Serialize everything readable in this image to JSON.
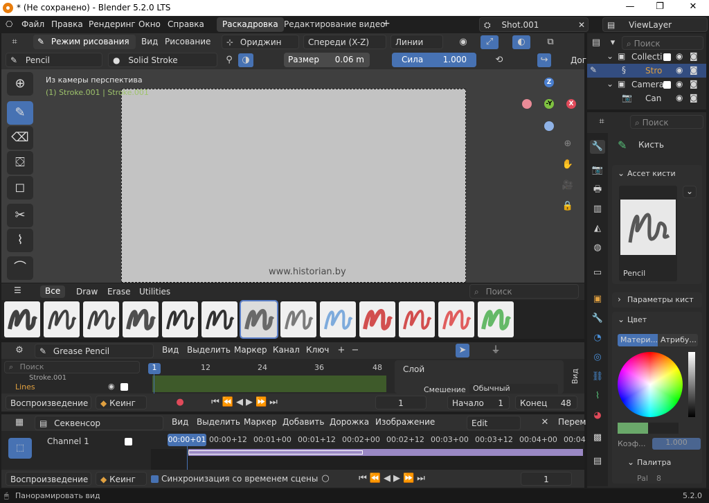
{
  "title": "* (Не сохранено) - Blender 5.2.0 LTS",
  "menu": [
    "Файл",
    "Правка",
    "Рендеринг",
    "Окно",
    "Справка"
  ],
  "workspaces": [
    "Раскадровка",
    "Редактирование видео"
  ],
  "scene": "Shot.001",
  "view_layer": "ViewLayer",
  "vp": {
    "mode": "Режим рисования",
    "view": "Вид",
    "draw": "Рисование",
    "origin": "Ориджин",
    "axis": "Спереди (X-Z)",
    "lines": "Линии",
    "brush": "Pencil",
    "stroke": "Solid Stroke",
    "size_label": "Размер",
    "size_val": "0.06 m",
    "strength_label": "Сила",
    "strength_val": "1.000",
    "extra": "Дог",
    "overlay1": "Из камеры перспектива",
    "overlay2": "(1) Stroke.001 | Stroke.001",
    "watermark": "www.historian.by"
  },
  "assets": {
    "tabs": [
      "Все",
      "Draw",
      "Erase",
      "Utilities"
    ],
    "search": "Поиск"
  },
  "dope": {
    "editor": "Grease Pencil",
    "menus": [
      "Вид",
      "Выделить",
      "Маркер",
      "Канал",
      "Ключ"
    ],
    "search": "Поиск",
    "frames": [
      "1",
      "12",
      "24",
      "36",
      "48"
    ],
    "row_top": "Stroke.001",
    "row": "Lines",
    "panel_title": "Слой",
    "blend_label": "Смешение",
    "blend_val": "Обычный",
    "side_tab": "Вид"
  },
  "pb": {
    "playback": "Воспроизведение",
    "keying": "Кеинг",
    "frame": "1",
    "start_label": "Начало",
    "start": "1",
    "end_label": "Конец",
    "end": "48"
  },
  "seq": {
    "editor": "Секвенсор",
    "menus": [
      "Вид",
      "Выделить",
      "Маркер",
      "Добавить",
      "Дорожка",
      "Изображение"
    ],
    "edit": "Edit",
    "more": "Перем",
    "channel": "Channel 1",
    "times": [
      "00:00+01",
      "00:00+12",
      "00:01+00",
      "00:01+12",
      "00:02+00",
      "00:02+12",
      "00:03+00",
      "00:03+12",
      "00:04+00",
      "00:04"
    ],
    "sync": "Синхронизация со временем сцены",
    "frame": "1"
  },
  "outliner": {
    "search": "Поиск",
    "rows": [
      "Collecti",
      "Stro",
      "Camera",
      "Can"
    ]
  },
  "props": {
    "search": "Поиск",
    "brush": "Кисть",
    "asset_panel": "Ассет кисти",
    "asset_name": "Pencil",
    "params": "Параметры кист",
    "color": "Цвет",
    "tab_mat": "Матери...",
    "tab_attr": "Атрибу...",
    "factor_label": "Коэф...",
    "factor_val": "1.000",
    "palette": "Палитра",
    "pal": "Pal",
    "pal_n": "8"
  },
  "status": {
    "left": "Панорамировать вид",
    "version": "5.2.0"
  }
}
